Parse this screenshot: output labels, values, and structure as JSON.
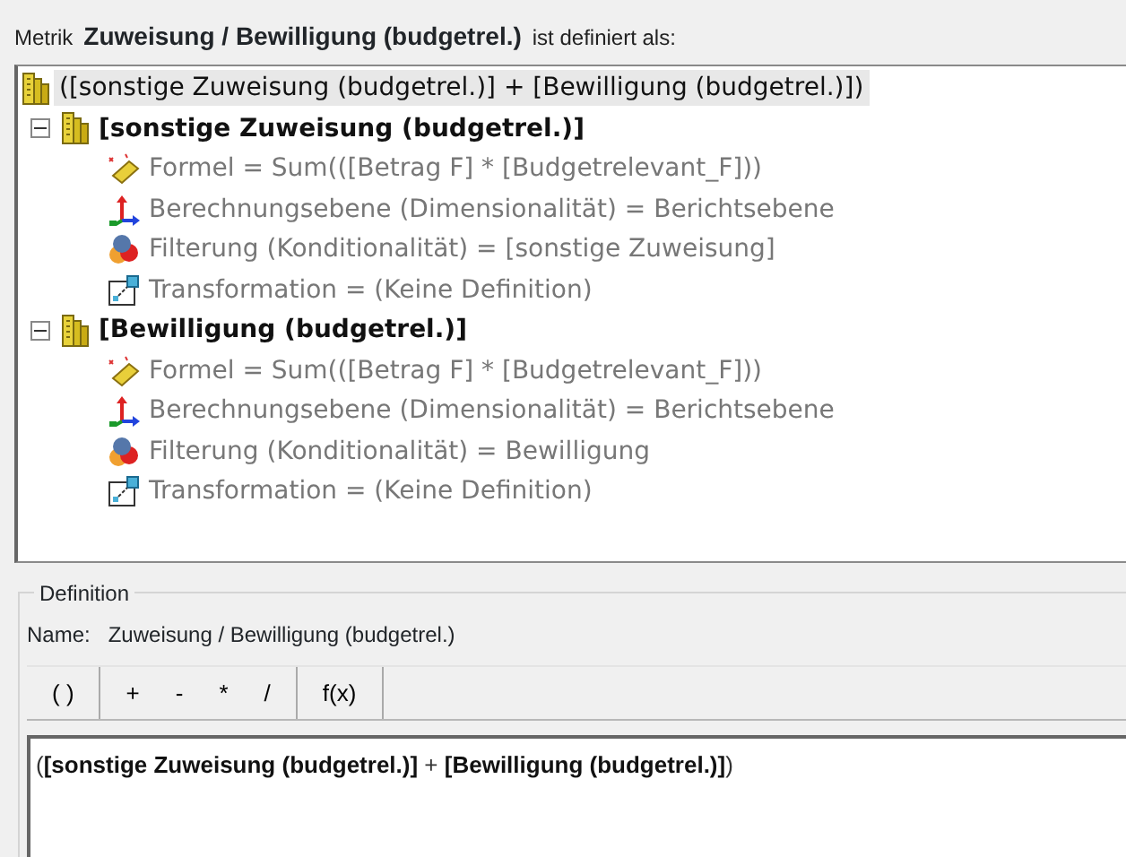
{
  "header": {
    "prefix": "Metrik",
    "metric_name": "Zuweisung / Bewilligung (budgetrel.)",
    "suffix": "ist definiert als:"
  },
  "tree": [
    {
      "label": "([sonstige Zuweisung (budgetrel.)] + [Bewilligung (budgetrel.)])",
      "kind": "metric",
      "selected": true,
      "children": [
        {
          "label": "[sonstige Zuweisung (budgetrel.)]",
          "kind": "metric",
          "selected": false,
          "expanded": true,
          "children": [
            {
              "kind": "formula",
              "label": "Formel = Sum(([Betrag F] * [Budgetrelevant_F]))",
              "selected": false
            },
            {
              "kind": "level",
              "label": "Berechnungsebene (Dimensionalität) = Berichtsebene",
              "selected": false
            },
            {
              "kind": "filter",
              "label": "Filterung (Konditionalität) = [sonstige Zuweisung]",
              "selected": false
            },
            {
              "kind": "transform",
              "label": "Transformation = (Keine Definition)",
              "selected": false
            }
          ]
        },
        {
          "label": "[Bewilligung (budgetrel.)]",
          "kind": "metric",
          "selected": false,
          "expanded": true,
          "children": [
            {
              "kind": "formula",
              "label": "Formel = Sum(([Betrag F] * [Budgetrelevant_F]))",
              "selected": false
            },
            {
              "kind": "level",
              "label": "Berechnungsebene (Dimensionalität) = Berichtsebene",
              "selected": false
            },
            {
              "kind": "filter",
              "label": "Filterung (Konditionalität) = Bewilligung",
              "selected": false
            },
            {
              "kind": "transform",
              "label": "Transformation = (Keine Definition)",
              "selected": false
            }
          ]
        }
      ]
    }
  ],
  "definition": {
    "title": "Definition",
    "name_label": "Name:",
    "name_value": "Zuweisung / Bewilligung (budgetrel.)",
    "toolbar": [
      [
        "( )"
      ],
      [
        "+",
        "-",
        "*",
        "/"
      ],
      [
        "f(x)"
      ]
    ],
    "expression": "(**[sonstige Zuweisung (budgetrel.)]** + **[Bewilligung (budgetrel.)]**)"
  }
}
